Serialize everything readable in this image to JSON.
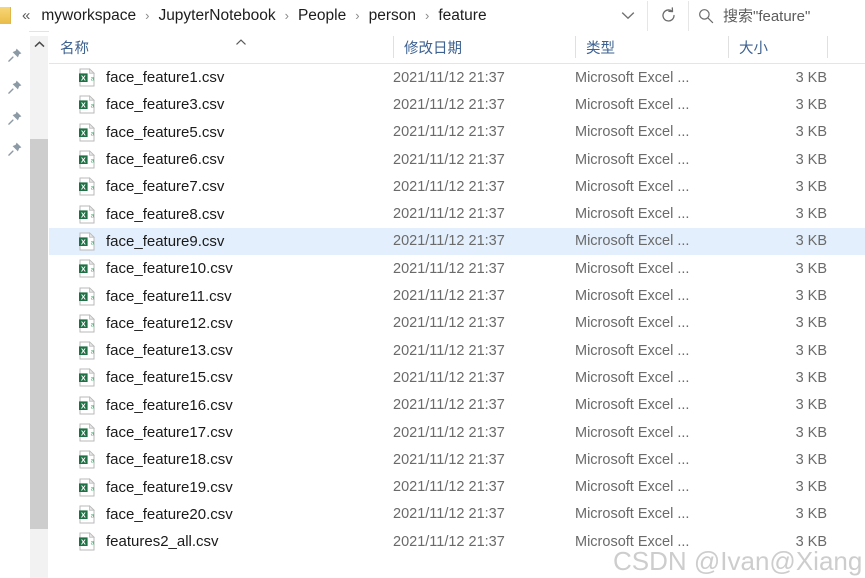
{
  "address_bar": {
    "folder_icon": "folder-icon",
    "back_chevrons": "«",
    "breadcrumb": [
      {
        "label": "myworkspace"
      },
      {
        "label": "JupyterNotebook"
      },
      {
        "label": "People"
      },
      {
        "label": "person"
      },
      {
        "label": "feature"
      }
    ],
    "breadcrumb_separator": "›",
    "dropdown_icon": "chevron-down-icon",
    "refresh_icon": "refresh-icon",
    "search": {
      "icon": "search-icon",
      "placeholder": "搜索\"feature\""
    }
  },
  "pin_rail": {
    "icon": "pin-icon",
    "count": 4
  },
  "scrollbar": {
    "up_arrow_icon": "chevron-up-icon"
  },
  "columns": {
    "name": "名称",
    "date_modified": "修改日期",
    "type": "类型",
    "size": "大小",
    "sort_icon": "sort-ascending-caret-icon"
  },
  "files": [
    {
      "name": "face_feature1.csv",
      "date": "2021/11/12 21:37",
      "type": "Microsoft Excel ...",
      "size": "3 KB",
      "selected": false,
      "icon": "excel-csv-icon"
    },
    {
      "name": "face_feature3.csv",
      "date": "2021/11/12 21:37",
      "type": "Microsoft Excel ...",
      "size": "3 KB",
      "selected": false,
      "icon": "excel-csv-icon"
    },
    {
      "name": "face_feature5.csv",
      "date": "2021/11/12 21:37",
      "type": "Microsoft Excel ...",
      "size": "3 KB",
      "selected": false,
      "icon": "excel-csv-icon"
    },
    {
      "name": "face_feature6.csv",
      "date": "2021/11/12 21:37",
      "type": "Microsoft Excel ...",
      "size": "3 KB",
      "selected": false,
      "icon": "excel-csv-icon"
    },
    {
      "name": "face_feature7.csv",
      "date": "2021/11/12 21:37",
      "type": "Microsoft Excel ...",
      "size": "3 KB",
      "selected": false,
      "icon": "excel-csv-icon"
    },
    {
      "name": "face_feature8.csv",
      "date": "2021/11/12 21:37",
      "type": "Microsoft Excel ...",
      "size": "3 KB",
      "selected": false,
      "icon": "excel-csv-icon"
    },
    {
      "name": "face_feature9.csv",
      "date": "2021/11/12 21:37",
      "type": "Microsoft Excel ...",
      "size": "3 KB",
      "selected": true,
      "icon": "excel-csv-icon"
    },
    {
      "name": "face_feature10.csv",
      "date": "2021/11/12 21:37",
      "type": "Microsoft Excel ...",
      "size": "3 KB",
      "selected": false,
      "icon": "excel-csv-icon"
    },
    {
      "name": "face_feature11.csv",
      "date": "2021/11/12 21:37",
      "type": "Microsoft Excel ...",
      "size": "3 KB",
      "selected": false,
      "icon": "excel-csv-icon"
    },
    {
      "name": "face_feature12.csv",
      "date": "2021/11/12 21:37",
      "type": "Microsoft Excel ...",
      "size": "3 KB",
      "selected": false,
      "icon": "excel-csv-icon"
    },
    {
      "name": "face_feature13.csv",
      "date": "2021/11/12 21:37",
      "type": "Microsoft Excel ...",
      "size": "3 KB",
      "selected": false,
      "icon": "excel-csv-icon"
    },
    {
      "name": "face_feature15.csv",
      "date": "2021/11/12 21:37",
      "type": "Microsoft Excel ...",
      "size": "3 KB",
      "selected": false,
      "icon": "excel-csv-icon"
    },
    {
      "name": "face_feature16.csv",
      "date": "2021/11/12 21:37",
      "type": "Microsoft Excel ...",
      "size": "3 KB",
      "selected": false,
      "icon": "excel-csv-icon"
    },
    {
      "name": "face_feature17.csv",
      "date": "2021/11/12 21:37",
      "type": "Microsoft Excel ...",
      "size": "3 KB",
      "selected": false,
      "icon": "excel-csv-icon"
    },
    {
      "name": "face_feature18.csv",
      "date": "2021/11/12 21:37",
      "type": "Microsoft Excel ...",
      "size": "3 KB",
      "selected": false,
      "icon": "excel-csv-icon"
    },
    {
      "name": "face_feature19.csv",
      "date": "2021/11/12 21:37",
      "type": "Microsoft Excel ...",
      "size": "3 KB",
      "selected": false,
      "icon": "excel-csv-icon"
    },
    {
      "name": "face_feature20.csv",
      "date": "2021/11/12 21:37",
      "type": "Microsoft Excel ...",
      "size": "3 KB",
      "selected": false,
      "icon": "excel-csv-icon"
    },
    {
      "name": "features2_all.csv",
      "date": "2021/11/12 21:37",
      "type": "Microsoft Excel ...",
      "size": "3 KB",
      "selected": false,
      "icon": "excel-csv-icon"
    }
  ],
  "watermark": {
    "text": "CSDN @Ivan@Xiang"
  },
  "colors": {
    "selection": "#e3effc",
    "column_header_text": "#3d6191",
    "secondary_text": "#6a6a6a",
    "excel_green": "#1e7145",
    "folder_yellow": "#f0c85c",
    "scroll_thumb": "#cdcdcd"
  }
}
